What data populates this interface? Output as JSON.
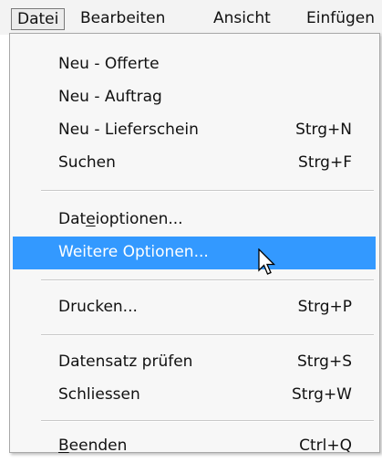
{
  "menubar": {
    "items": [
      {
        "label": "Datei"
      },
      {
        "label": "Bearbeiten"
      },
      {
        "label": "Ansicht"
      },
      {
        "label": "Einfügen"
      }
    ]
  },
  "menu": {
    "items": [
      {
        "label": "Neu - Offerte",
        "shortcut": ""
      },
      {
        "label": "Neu - Auftrag",
        "shortcut": ""
      },
      {
        "label": "Neu - Lieferschein",
        "shortcut": "Strg+N"
      },
      {
        "label": "Suchen",
        "shortcut": "Strg+F"
      },
      {
        "label_pre": "Dat",
        "label_u": "e",
        "label_post": "ioptionen...",
        "shortcut": ""
      },
      {
        "label": "Weitere Optionen...",
        "shortcut": ""
      },
      {
        "label": "Drucken...",
        "shortcut": "Strg+P"
      },
      {
        "label": "Datensatz prüfen",
        "shortcut": "Strg+S"
      },
      {
        "label": "Schliessen",
        "shortcut": "Strg+W"
      },
      {
        "label_u": "B",
        "label_post": "eenden",
        "shortcut": "Ctrl+Q"
      }
    ]
  },
  "colors": {
    "highlight": "#3399ff",
    "menu_background": "#f7f7f7",
    "menubar_background": "#f3f3f3"
  },
  "icons": {
    "cursor": "arrow-pointer-icon"
  }
}
